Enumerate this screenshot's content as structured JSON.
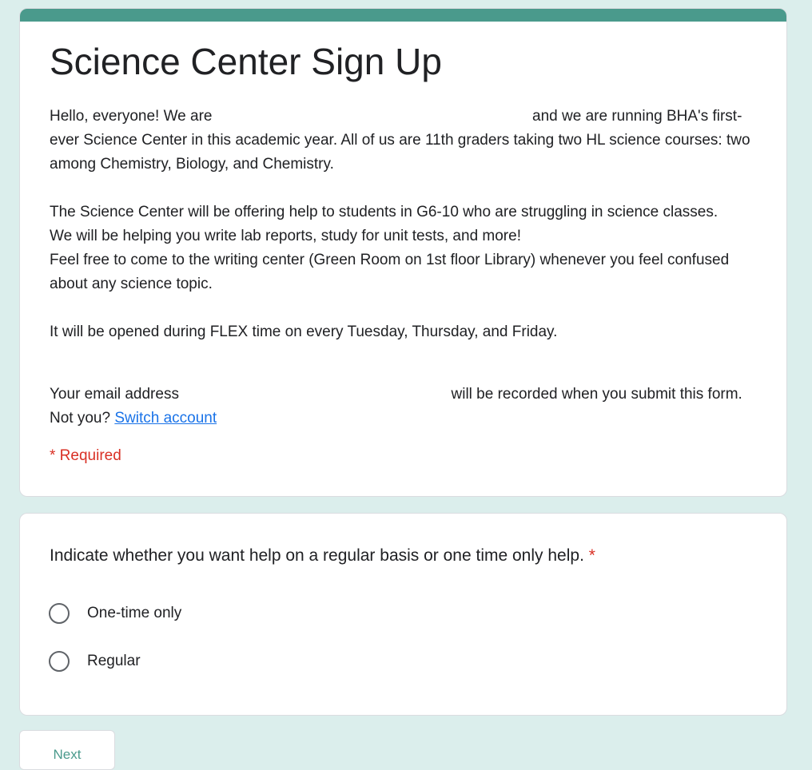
{
  "form": {
    "title": "Science Center Sign Up",
    "description": {
      "line1_start": "Hello, everyone! We are",
      "line1_end": "and we are running BHA's first-ever Science Center in this academic year. All of us are 11th graders taking two HL science courses: two among Chemistry, Biology, and Chemistry.",
      "para2": "The Science Center will be offering help to students in G6-10 who are struggling in science classes.",
      "para3": "We will be helping you write lab reports, study for unit tests, and more!",
      "para4": "Feel free to come to the writing center (Green Room on 1st floor Library) whenever you feel confused about any science topic.",
      "para5": "It will be opened during FLEX time on every Tuesday, Thursday, and Friday."
    },
    "email_notice": {
      "prefix": "Your email address",
      "suffix": "will be recorded when you submit this form. Not you?",
      "switch_link": "Switch account"
    },
    "required_note": "* Required",
    "accent_color": "#4a9a8c",
    "required_color": "#d93025"
  },
  "question": {
    "title": "Indicate whether you want help on a regular basis or one time only help.",
    "required_star": "*",
    "options": [
      {
        "label": "One-time only",
        "selected": false
      },
      {
        "label": "Regular",
        "selected": false
      }
    ]
  },
  "footer": {
    "next_label": "Next"
  }
}
